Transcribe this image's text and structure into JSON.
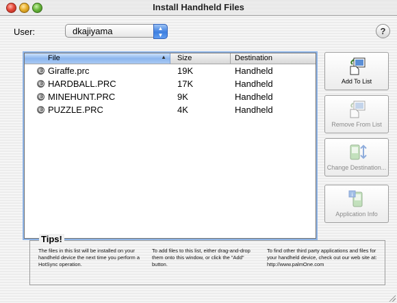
{
  "window": {
    "title": "Install Handheld Files"
  },
  "user": {
    "label": "User:",
    "value": "dkajiyama"
  },
  "help": {
    "label": "?"
  },
  "list": {
    "columns": {
      "file": "File",
      "size": "Size",
      "destination": "Destination"
    },
    "rows": [
      {
        "file": "Giraffe.prc",
        "size": "19K",
        "destination": "Handheld"
      },
      {
        "file": "HARDBALL.PRC",
        "size": "17K",
        "destination": "Handheld"
      },
      {
        "file": "MINEHUNT.PRC",
        "size": "9K",
        "destination": "Handheld"
      },
      {
        "file": "PUZZLE.PRC",
        "size": "4K",
        "destination": "Handheld"
      }
    ]
  },
  "buttons": {
    "add": "Add To List",
    "remove": "Remove From List",
    "change": "Change Destination...",
    "info": "Application Info"
  },
  "tips": {
    "title": "Tips!",
    "tip1": "The files in this list will be installed on your handheld device the next time you perform a HotSync operation.",
    "tip2": "To add files to this list, either drag-and-drop them onto this window, or click the \"Add\" button.",
    "tip3": "To find other third party applications and files for your handheld device, check out our web site at: http://www.palmOne.com"
  },
  "colors": {
    "accent": "#3d7fe0",
    "selection_header": "#8bb6ee"
  },
  "icons": [
    "close-icon",
    "minimize-icon",
    "zoom-icon",
    "popup-arrows-icon",
    "help-icon",
    "file-icon",
    "add-to-list-icon",
    "remove-from-list-icon",
    "change-destination-icon",
    "application-info-icon",
    "resize-grip-icon"
  ]
}
